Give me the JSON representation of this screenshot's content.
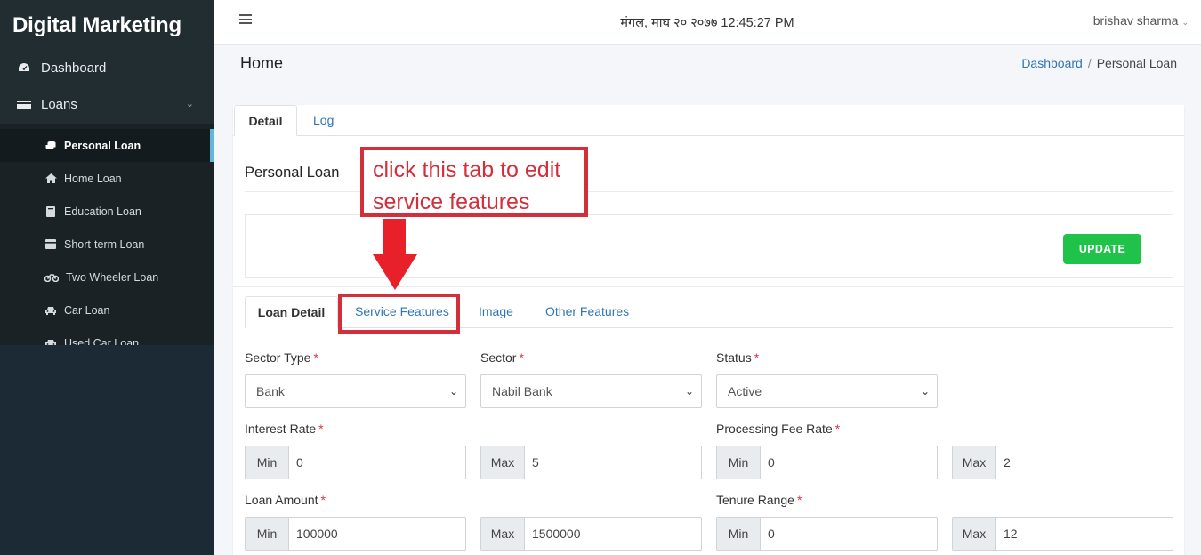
{
  "sidebar": {
    "brand": "Digital Marketing",
    "dashboard": "Dashboard",
    "loans": "Loans",
    "items": [
      {
        "label": "Personal Loan",
        "icon": "coins-icon"
      },
      {
        "label": "Home Loan",
        "icon": "home-icon"
      },
      {
        "label": "Education Loan",
        "icon": "book-icon"
      },
      {
        "label": "Short-term Loan",
        "icon": "card-icon"
      },
      {
        "label": "Two Wheeler Loan",
        "icon": "motorcycle-icon"
      },
      {
        "label": "Car Loan",
        "icon": "car-icon"
      },
      {
        "label": "Used Car Loan",
        "icon": "car-icon"
      }
    ]
  },
  "topbar": {
    "datetime": "मंगल, माघ २० २०७७ 12:45:27 PM",
    "user": "brishav sharma"
  },
  "header": {
    "title": "Home",
    "breadcrumb_home": "Dashboard",
    "breadcrumb_current": "Personal Loan"
  },
  "tabs": {
    "detail": "Detail",
    "log": "Log"
  },
  "section": {
    "title": "Personal Loan",
    "update": "UPDATE"
  },
  "subtabs": {
    "loan_detail": "Loan Detail",
    "service_features": "Service Features",
    "image": "Image",
    "other_features": "Other Features"
  },
  "form": {
    "sector_type": {
      "label": "Sector Type",
      "value": "Bank"
    },
    "sector": {
      "label": "Sector",
      "value": "Nabil Bank"
    },
    "status": {
      "label": "Status",
      "value": "Active"
    },
    "interest_rate": {
      "label": "Interest Rate",
      "min": "0",
      "max": "5"
    },
    "processing_fee": {
      "label": "Processing Fee Rate",
      "min": "0",
      "max": "2"
    },
    "loan_amount": {
      "label": "Loan Amount",
      "min": "100000",
      "max": "1500000"
    },
    "tenure_range": {
      "label": "Tenure Range",
      "min": "0",
      "max": "12"
    },
    "min_label": "Min",
    "max_label": "Max",
    "required_mark": "*"
  },
  "annotation": {
    "line1": "click this tab to edit",
    "line2": "service features"
  },
  "colors": {
    "sidebar_bg": "#222d32",
    "accent_link": "#2f76b5",
    "update_green": "#1fc34a",
    "annotation_red": "#d32f3a"
  }
}
